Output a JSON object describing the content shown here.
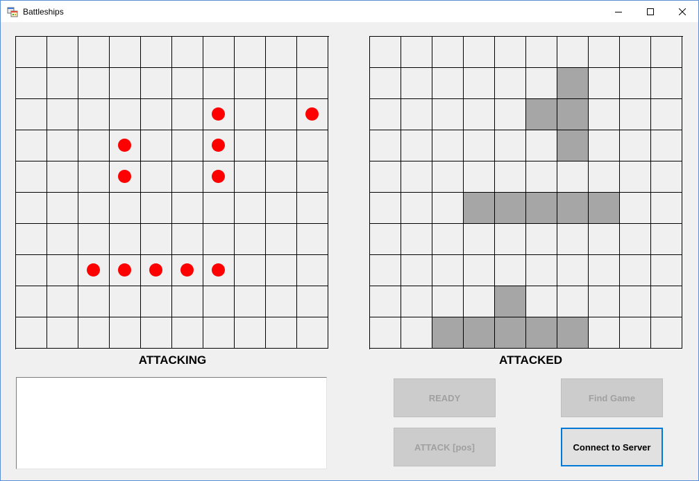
{
  "window": {
    "title": "Battleships",
    "app_icon": "windows-forms-icon"
  },
  "title_controls": {
    "minimize_icon": "minimize-icon",
    "maximize_icon": "maximize-icon",
    "close_icon": "close-icon"
  },
  "boards": {
    "attacking": {
      "label": "ATTACKING",
      "rows": 10,
      "cols": 10,
      "hit_markers": [
        [
          2,
          6
        ],
        [
          2,
          9
        ],
        [
          3,
          3
        ],
        [
          3,
          6
        ],
        [
          4,
          3
        ],
        [
          4,
          6
        ],
        [
          7,
          2
        ],
        [
          7,
          3
        ],
        [
          7,
          4
        ],
        [
          7,
          5
        ],
        [
          7,
          6
        ]
      ],
      "marker_color": "#ff0000"
    },
    "attacked": {
      "label": "ATTACKED",
      "rows": 10,
      "cols": 10,
      "ship_cells": [
        [
          1,
          6
        ],
        [
          2,
          5
        ],
        [
          2,
          6
        ],
        [
          3,
          6
        ],
        [
          5,
          3
        ],
        [
          5,
          4
        ],
        [
          5,
          5
        ],
        [
          5,
          6
        ],
        [
          5,
          7
        ],
        [
          8,
          4
        ],
        [
          9,
          2
        ],
        [
          9,
          3
        ],
        [
          9,
          4
        ],
        [
          9,
          5
        ],
        [
          9,
          6
        ]
      ],
      "ship_color": "#a6a6a6"
    }
  },
  "log": {
    "value": ""
  },
  "buttons": {
    "ready": {
      "label": "READY",
      "enabled": false
    },
    "find_game": {
      "label": "Find Game",
      "enabled": false
    },
    "attack": {
      "label": "ATTACK [pos]",
      "enabled": false
    },
    "connect": {
      "label": "Connect to Server",
      "enabled": true
    }
  },
  "colors": {
    "accent": "#0078d7",
    "grid_line": "#000000",
    "background": "#f0f0f0"
  }
}
